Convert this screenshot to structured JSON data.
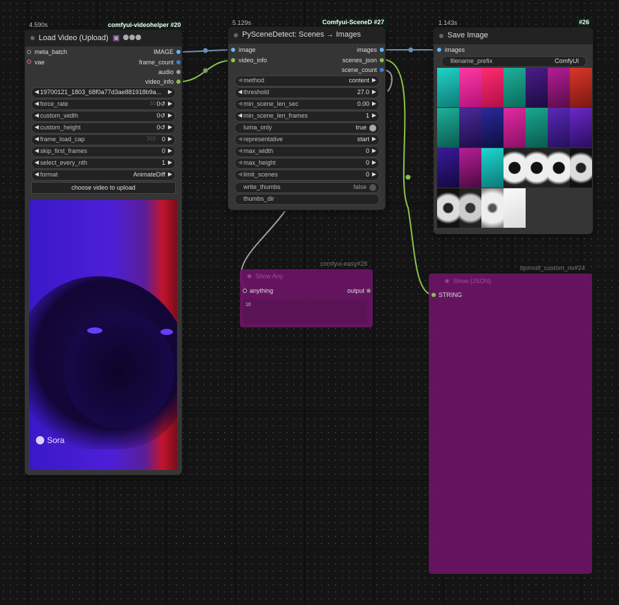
{
  "canvas": {
    "background": "#141414",
    "link_color_image": "#6e8eb1",
    "link_color_string": "#8bc34a",
    "link_color_any": "#9e9e9e"
  },
  "nodes": {
    "load_video": {
      "exec_time": "4.590s",
      "badge": "comfyui-videohelper",
      "node_id": "#20",
      "title": "Load Video (Upload)",
      "title_icons": [
        "movie-icon",
        "V",
        "H",
        "S"
      ],
      "inputs": [
        {
          "label": "meta_batch",
          "color": "#9e9e9e"
        },
        {
          "label": "vae",
          "color": "#e57373"
        }
      ],
      "outputs": [
        {
          "label": "IMAGE",
          "color": "#64b5f6"
        },
        {
          "label": "frame_count",
          "color": "#3f7fd9"
        },
        {
          "label": "audio",
          "color": "#9e9e9e"
        },
        {
          "label": "video_info",
          "color": "#8bc34a"
        }
      ],
      "widgets": [
        {
          "label": "19700121_1803_68f0a77d3ae881918b9a...",
          "value": "",
          "placeholder": ""
        },
        {
          "label": "force_rate",
          "value": "0↺",
          "placeholder": "30"
        },
        {
          "label": "custom_width",
          "value": "0↺",
          "placeholder": ""
        },
        {
          "label": "custom_height",
          "value": "0↺",
          "placeholder": ""
        },
        {
          "label": "frame_load_cap",
          "value": "0",
          "placeholder": "303"
        },
        {
          "label": "skip_first_frames",
          "value": "0",
          "placeholder": ""
        },
        {
          "label": "select_every_nth",
          "value": "1",
          "placeholder": ""
        },
        {
          "label": "format",
          "value": "AnimateDiff",
          "placeholder": ""
        }
      ],
      "upload_button": "choose video to upload",
      "preview_watermark": "Sora"
    },
    "scene_detect": {
      "exec_time": "5.129s",
      "badge": "Comfyui-SceneD",
      "node_id": "#27",
      "title": "PySceneDetect: Scenes → Images",
      "inputs": [
        {
          "label": "image",
          "color": "#64b5f6"
        },
        {
          "label": "video_info",
          "color": "#8bc34a"
        }
      ],
      "outputs": [
        {
          "label": "images",
          "color": "#64b5f6"
        },
        {
          "label": "scenes_json",
          "color": "#8bc34a"
        },
        {
          "label": "scene_count",
          "color": "#3f7fd9"
        }
      ],
      "widgets": [
        {
          "label": "method",
          "value": "content",
          "kind": "combo",
          "dim": true
        },
        {
          "label": "threshold",
          "value": "27.0",
          "kind": "number"
        },
        {
          "label": "min_scene_len_sec",
          "value": "0.00",
          "kind": "number",
          "dim": true
        },
        {
          "label": "min_scene_len_frames",
          "value": "1",
          "kind": "number"
        },
        {
          "label": "luma_only",
          "value": "true",
          "kind": "toggle",
          "on": true
        },
        {
          "label": "representative",
          "value": "start",
          "kind": "combo",
          "dim": true
        },
        {
          "label": "max_width",
          "value": "0",
          "kind": "number",
          "dim": true
        },
        {
          "label": "max_height",
          "value": "0",
          "kind": "number",
          "dim": true
        },
        {
          "label": "limit_scenes",
          "value": "0",
          "kind": "number",
          "dim": true
        },
        {
          "label": "write_thumbs",
          "value": "false",
          "kind": "toggle",
          "on": false
        },
        {
          "label": "thumbs_dir",
          "value": "",
          "kind": "text"
        }
      ]
    },
    "save_image": {
      "exec_time": "1.143s",
      "node_id": "#26",
      "title": "Save Image",
      "inputs": [
        {
          "label": "images",
          "color": "#64b5f6"
        }
      ],
      "widgets": [
        {
          "label": "filename_prefix",
          "value": "ComfyUI"
        }
      ],
      "thumbnail_count": 25
    },
    "show_any": {
      "badge": "comfyui-easy",
      "node_id": "#28",
      "title": "Show Any",
      "input": "anything",
      "output": "output",
      "text_value": "10"
    },
    "show_json": {
      "badge": "bjornulf_custom_no",
      "node_id": "#24",
      "title": "Show (JSON)",
      "input": "STRING"
    }
  }
}
